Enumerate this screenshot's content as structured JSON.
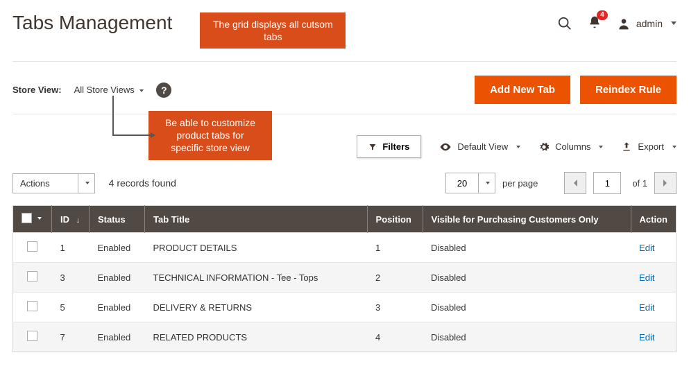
{
  "header": {
    "title": "Tabs Management",
    "annotation_top": "The grid displays all cutsom tabs",
    "notification_count": "4",
    "admin_label": "admin"
  },
  "storeview": {
    "label": "Store View:",
    "value": "All Store Views",
    "annotation": "Be able to customize product tabs for specific store view"
  },
  "buttons": {
    "add_new_tab": "Add New Tab",
    "reindex": "Reindex Rule"
  },
  "toolbar": {
    "filters": "Filters",
    "default_view": "Default View",
    "columns": "Columns",
    "export": "Export"
  },
  "listing": {
    "actions_label": "Actions",
    "records_found": "4 records found",
    "per_page_value": "20",
    "per_page_label": "per page",
    "current_page": "1",
    "of_label": "of 1"
  },
  "grid": {
    "headers": {
      "id": "ID",
      "status": "Status",
      "title": "Tab Title",
      "position": "Position",
      "visible": "Visible for Purchasing Customers Only",
      "action": "Action"
    },
    "edit_label": "Edit",
    "rows": [
      {
        "id": "1",
        "status": "Enabled",
        "title": "PRODUCT DETAILS",
        "position": "1",
        "visible": "Disabled"
      },
      {
        "id": "3",
        "status": "Enabled",
        "title": "TECHNICAL INFORMATION - Tee - Tops",
        "position": "2",
        "visible": "Disabled"
      },
      {
        "id": "5",
        "status": "Enabled",
        "title": "DELIVERY & RETURNS",
        "position": "3",
        "visible": "Disabled"
      },
      {
        "id": "7",
        "status": "Enabled",
        "title": "RELATED PRODUCTS",
        "position": "4",
        "visible": "Disabled"
      }
    ]
  }
}
